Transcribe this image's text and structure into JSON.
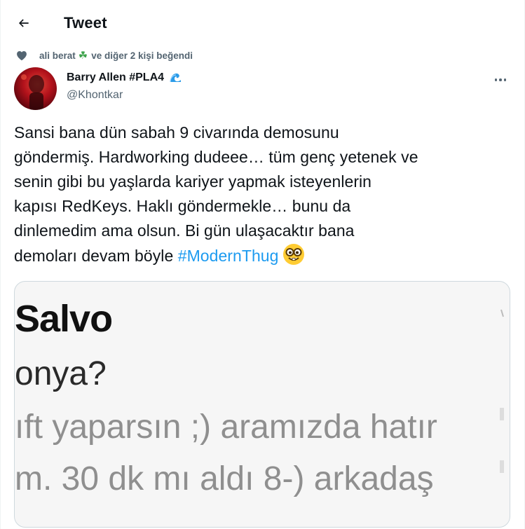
{
  "header": {
    "title": "Tweet"
  },
  "social_context": {
    "name": "ali berat",
    "suffix": "ve diğer 2 kişi beğendi"
  },
  "author": {
    "display_name": "Barry Allen #PLA4",
    "handle": "@Khontkar"
  },
  "tweet": {
    "lines": [
      "Sansi bana dün sabah 9 civarında demosunu",
      "göndermiş. Hardworking dudeee… tüm genç yetenek ve",
      "senin gibi bu yaşlarda kariyer yapmak isteyenlerin",
      "kapısı RedKeys. Haklı göndermekle… bunu da",
      "dinlemedim ama olsun. Bi gün ulaşacaktır bana"
    ],
    "last_line_text": "demoları devam böyle ",
    "hashtag": "#ModernThug"
  },
  "media": {
    "lines": [
      "Salvo",
      "onya?",
      "ıft yaparsın ;) aramızda hatır",
      "m. 30 dk mı aldı 8-) arkadaş"
    ]
  },
  "colors": {
    "accent": "#1d9bf0",
    "muted": "#536471",
    "text": "#0f1419"
  },
  "icons": [
    "back-arrow-icon",
    "heart-icon",
    "clover-icon",
    "wave-icon",
    "more-icon",
    "nerd-face-icon"
  ]
}
